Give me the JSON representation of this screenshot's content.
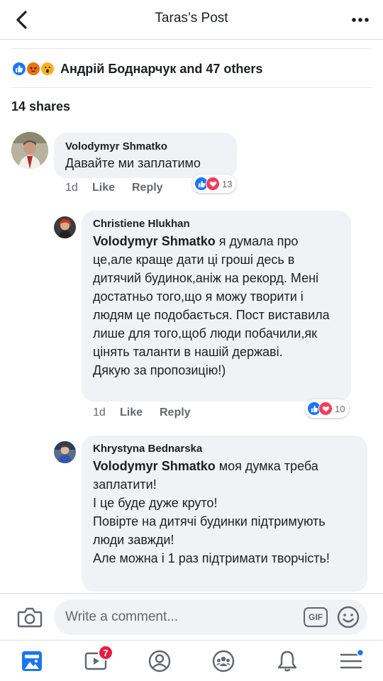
{
  "header": {
    "title": "Taras’s Post",
    "back_icon": "chevron-left-icon",
    "more_icon": "more-horizontal-icon"
  },
  "reactions": {
    "icons": [
      "like",
      "angry",
      "wow"
    ],
    "summary": "Андрій Боднарчук and 47 others"
  },
  "shares": "14 shares",
  "comments": [
    {
      "author": "Volodymyr Shmatko",
      "text": "Давайте ми заплатимо",
      "time": "1d",
      "like_label": "Like",
      "reply_label": "Reply",
      "reaction_count": "13",
      "reaction_icons": [
        "like",
        "love"
      ]
    },
    {
      "author": "Christiene Hlukhan",
      "mention": "Volodymyr Shmatko",
      "text": " я думала про це,але краще дати ці гроші десь в дитячий будинок,аніж на рекорд. Мені достатньо того,що я можу творити і людям це подобається. Пост виставила лише для того,щоб люди побачили,як цінять таланти в нашій державі.\nДякую за пропозицію!)",
      "time": "1d",
      "like_label": "Like",
      "reply_label": "Reply",
      "reaction_count": "10",
      "reaction_icons": [
        "like",
        "love"
      ]
    },
    {
      "author": "Khrystyna Bednarska",
      "mention": "Volodymyr Shmatko",
      "text": " моя думка треба заплатити!\nІ це буде дуже круто!\nПовірте на дитячі будинки підтримують люди завжди!\nАле можна і 1 раз підтримати творчість!"
    }
  ],
  "composer": {
    "placeholder": "Write a comment...",
    "gif_label": "GIF"
  },
  "bottom_nav": {
    "items": [
      {
        "icon": "news-feed-icon",
        "active": true
      },
      {
        "icon": "watch-icon",
        "badge": "7"
      },
      {
        "icon": "profile-icon"
      },
      {
        "icon": "groups-icon"
      },
      {
        "icon": "notifications-icon"
      },
      {
        "icon": "menu-icon",
        "dot": true
      }
    ]
  },
  "colors": {
    "brand_blue": "#1877f2",
    "love_red": "#f33e58",
    "angry_orange": "#e9710f",
    "wow_yellow": "#f7b125",
    "badge_red": "#e41e3f"
  }
}
